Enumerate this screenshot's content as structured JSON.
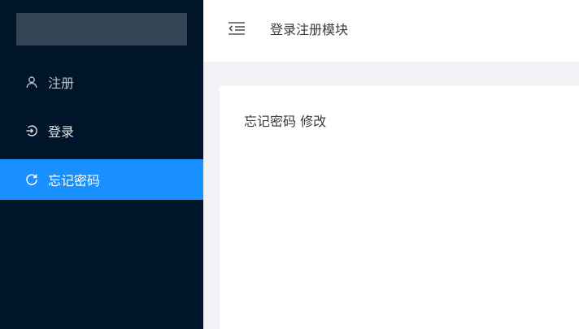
{
  "sidebar": {
    "items": [
      {
        "label": "注册",
        "icon": "user-icon"
      },
      {
        "label": "登录",
        "icon": "login-icon"
      },
      {
        "label": "忘记密码",
        "icon": "reload-icon",
        "selected": true
      }
    ],
    "selected_color": "#1890ff",
    "background_color": "#001529"
  },
  "header": {
    "title": "登录注册模块",
    "toggle_icon": "menu-fold-icon"
  },
  "content": {
    "text": "忘记密码 修改"
  }
}
